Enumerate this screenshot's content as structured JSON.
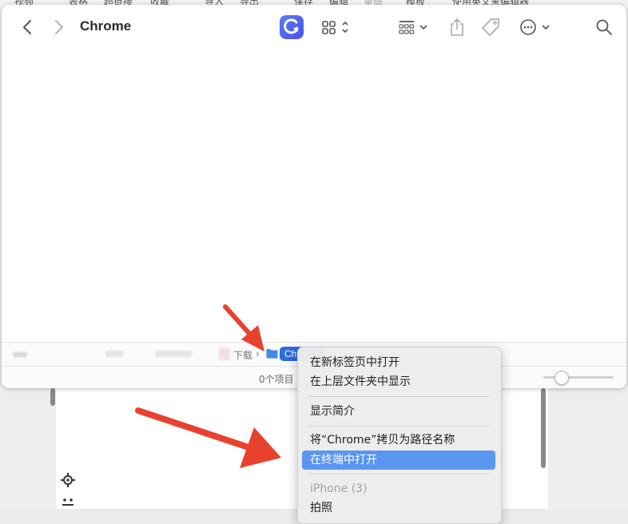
{
  "background": {
    "toolbar_labels": [
      "视频",
      "表格",
      "超链接",
      "收藏",
      "导入",
      "导出",
      "保存",
      "编辑",
      "重做",
      "模板",
      "使用英文来编辑器"
    ]
  },
  "window": {
    "title": "Chrome",
    "pathbar": {
      "parent": "下载",
      "separator": "›",
      "current": "Chrome"
    },
    "status": {
      "count": "0个项目"
    }
  },
  "context_menu": {
    "items": [
      {
        "label": "在新标签页中打开"
      },
      {
        "label": "在上层文件夹中显示"
      },
      {
        "label": "显示简介"
      },
      {
        "label": "将“Chrome”拷贝为路径名称"
      },
      {
        "label": "在终端中打开",
        "highlighted": true
      },
      {
        "label": "iPhone (3)",
        "disabled": true
      },
      {
        "label": "拍照"
      }
    ]
  },
  "colors": {
    "accent": "#2d6be0",
    "menu_highlight": "#5b95f2",
    "annotation_arrow": "#e8412c"
  },
  "icons": [
    "back-icon",
    "forward-icon",
    "app-icon",
    "view-grid-icon",
    "group-icon",
    "share-icon",
    "tag-icon",
    "more-icon",
    "search-icon",
    "folder-icon"
  ]
}
